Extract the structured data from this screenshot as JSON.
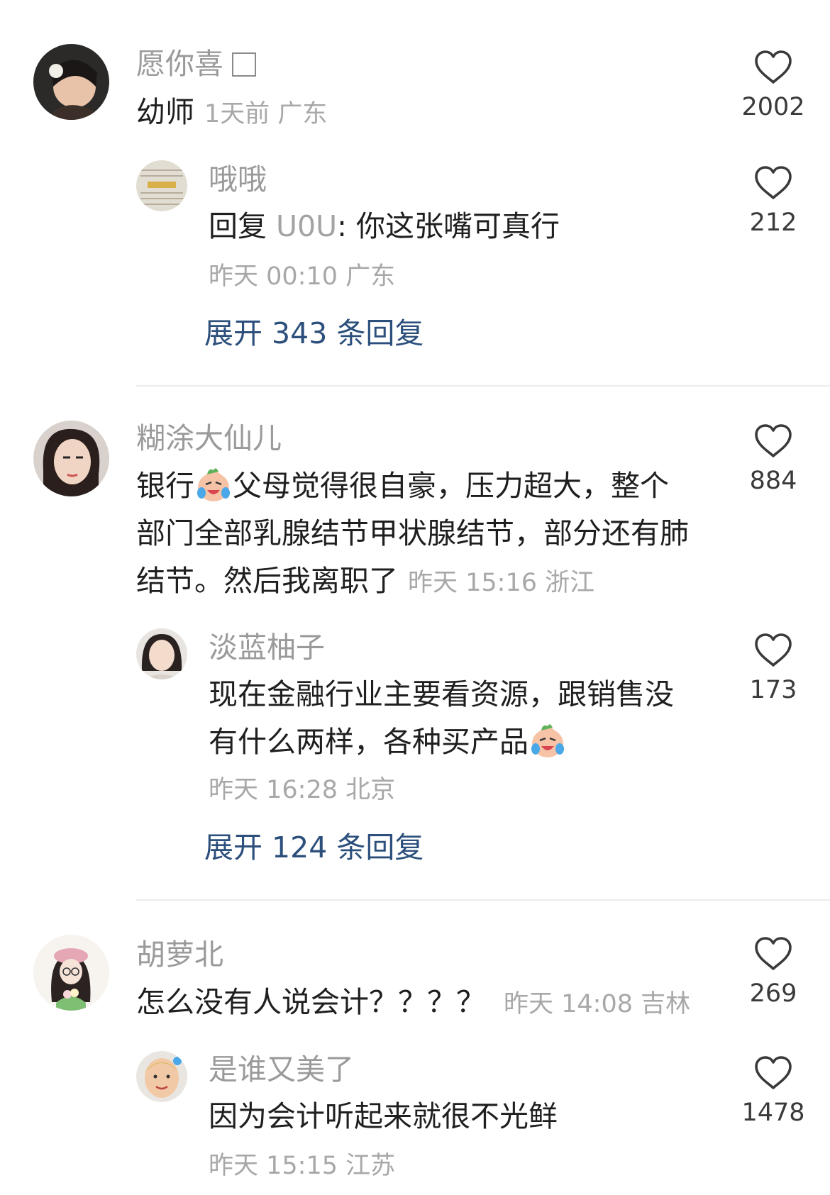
{
  "comments": [
    {
      "name": "愿你喜",
      "text": "幼师",
      "meta": "1天前 广东",
      "likes": "2002",
      "reply": {
        "name": "哦哦",
        "prefix": "回复",
        "target": "U0U",
        "text": ": 你这张嘴可真行",
        "meta": "昨天 00:10 广东",
        "likes": "212"
      },
      "expand": "展开 343 条回复"
    },
    {
      "name": "糊涂大仙儿",
      "line1a": "银行",
      "line1b": "父母觉得很自豪，压力超大，整个",
      "line2": "部门全部乳腺结节甲状腺结节，部分还有肺",
      "line3": "结节。然后我离职了",
      "meta": "昨天 15:16 浙江",
      "likes": "884",
      "reply": {
        "name": "淡蓝柚子",
        "line1": "现在金融行业主要看资源，跟销售没",
        "line2": "有什么两样，各种买产品",
        "meta": "昨天 16:28 北京",
        "likes": "173"
      },
      "expand": "展开 124 条回复"
    },
    {
      "name": "胡萝北",
      "text": "怎么没有人说会计？？？？",
      "meta": "昨天 14:08 吉林",
      "likes": "269",
      "reply": {
        "name": "是谁又美了",
        "text": "因为会计听起来就很不光鲜",
        "meta": "昨天 15:15 江苏",
        "likes": "1478"
      }
    }
  ],
  "icons": {
    "like": "heart-outline-icon",
    "emoji": "crying-laughing-emoji",
    "box": "empty-square-icon"
  },
  "colors": {
    "name": "#9a9a9a",
    "meta": "#a8a8a8",
    "expand": "#2c4f7c"
  }
}
